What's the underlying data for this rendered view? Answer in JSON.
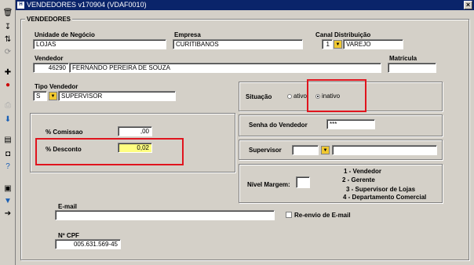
{
  "window": {
    "title": "VENDEDORES v170904 (VDAF0010)",
    "close_label": "×"
  },
  "toolbar_icons": [
    "trash-icon",
    "arrow-icon",
    "sort-icon",
    "refresh-icon",
    "add-icon",
    "delete-icon",
    "print-icon",
    "down-arrow-icon",
    "doc-icon",
    "camera-icon",
    "help-icon",
    "save-icon",
    "cancel-icon",
    "exit-icon"
  ],
  "section_title": "VENDEDORES",
  "unidade": {
    "label": "Unidade de Negócio",
    "value": "LOJAS"
  },
  "empresa": {
    "label": "Empresa",
    "value": "CURITIBANOS"
  },
  "canal": {
    "label": "Canal Distribuição",
    "code": "1",
    "value": "VAREJO"
  },
  "vendedor": {
    "label": "Vendedor",
    "code": "46290",
    "name": "FERNANDO PEREIRA DE SOUZA"
  },
  "matricula": {
    "label": "Matrícula",
    "value": ""
  },
  "tipo_vendedor": {
    "label": "Tipo Vendedor",
    "code": "S",
    "value": "SUPERVISOR"
  },
  "situacao": {
    "label": "Situação",
    "options": [
      "ativo",
      "inativo"
    ],
    "selected": "inativo"
  },
  "comissao": {
    "label": "% Comissao",
    "value": ",00"
  },
  "desconto": {
    "label": "% Desconto",
    "value": "0,02"
  },
  "senha": {
    "label": "Senha do Vendedor",
    "value": "***"
  },
  "supervisor": {
    "label": "Supervisor",
    "code": "",
    "value": ""
  },
  "nivel_margem": {
    "label": "Nível Margem:",
    "value": "",
    "legend": [
      "1 - Vendedor",
      "2 - Gerente",
      "3 - Supervisor de Lojas",
      "4 - Departamento Comercial"
    ]
  },
  "email": {
    "label": "E-mail",
    "value": "",
    "reenvio_label": "Re-envio de E-mail"
  },
  "cpf": {
    "label": "Nº CPF",
    "value": "005.631.569-45"
  }
}
